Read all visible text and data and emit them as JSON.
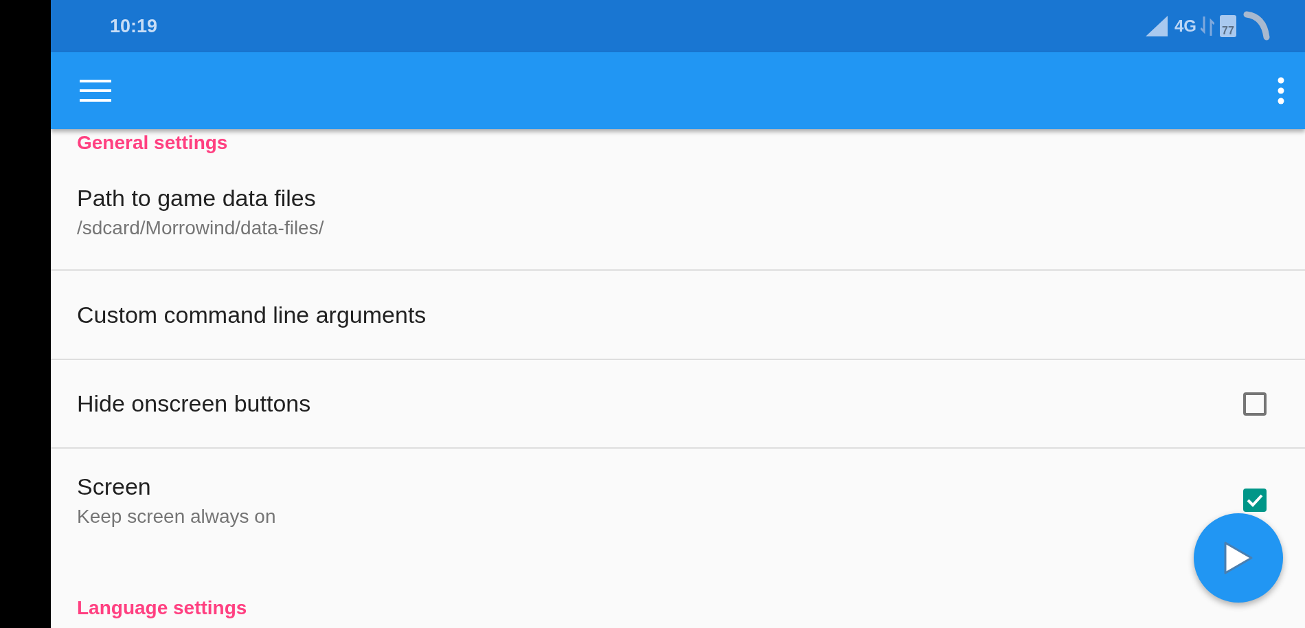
{
  "status_bar": {
    "time": "10:19",
    "network": "4G",
    "battery": "77"
  },
  "sections": [
    {
      "title": "General settings",
      "items": [
        {
          "kind": "text",
          "title": "Path to game data files",
          "summary": "/sdcard/Morrowind/data-files/"
        },
        {
          "kind": "text",
          "title": "Custom command line arguments"
        },
        {
          "kind": "checkbox",
          "title": "Hide onscreen buttons",
          "checked": false
        },
        {
          "kind": "checkbox",
          "title": "Screen",
          "summary": "Keep screen always on",
          "checked": true
        }
      ]
    },
    {
      "title": "Language settings"
    }
  ]
}
